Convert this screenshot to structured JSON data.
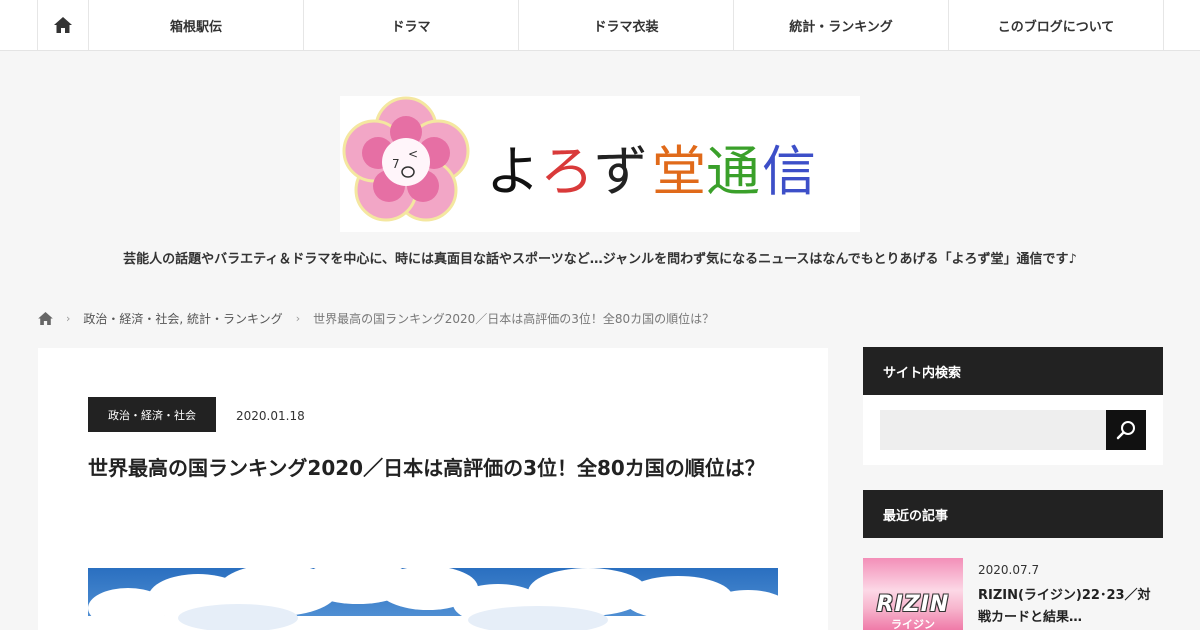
{
  "nav": {
    "items": [
      "箱根駅伝",
      "ドラマ",
      "ドラマ衣装",
      "統計・ランキング",
      "このブログについて"
    ]
  },
  "logo": {
    "text": "よろず堂通信"
  },
  "tagline": "芸能人の話題やバラエティ＆ドラマを中心に、時には真面目な話やスポーツなど…ジャンルを問わず気になるニュースはなんでもとりあげる「よろず堂」通信です♪",
  "breadcrumb": {
    "category": "政治・経済・社会, 統計・ランキング",
    "current": "世界最高の国ランキング2020／日本は高評価の3位！全80カ国の順位は？"
  },
  "post": {
    "category": "政治・経済・社会",
    "date": "2020.01.18",
    "title": "世界最高の国ランキング2020／日本は高評価の3位！全80カ国の順位は？"
  },
  "sidebar": {
    "search_title": "サイト内検索",
    "search_placeholder": "",
    "recent_title": "最近の記事",
    "recent": [
      {
        "date": "2020.07.7",
        "title": "RIZIN(ライジン)22･23／対戦カードと結果…",
        "thumb_text": "RIZIN",
        "thumb_sub": "ライジン"
      }
    ]
  },
  "colors": {
    "header_dark": "#222222",
    "accent_pink": "#ef7aa8"
  }
}
